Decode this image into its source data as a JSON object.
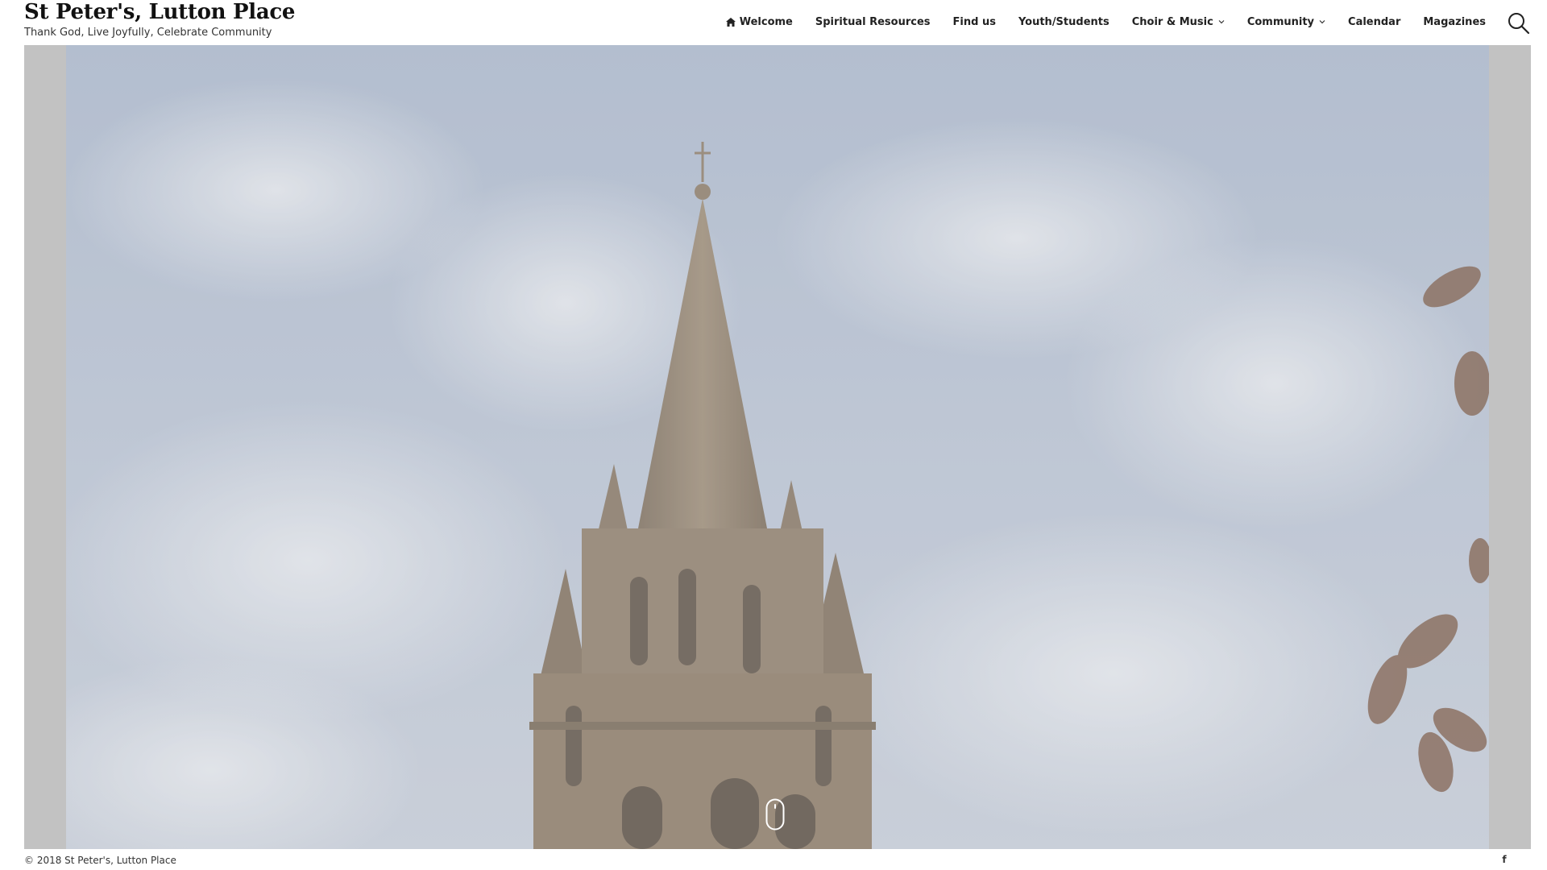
{
  "site": {
    "title": "St Peter's, Lutton Place",
    "tagline": "Thank God, Live Joyfully, Celebrate Community"
  },
  "nav": {
    "items": [
      {
        "label": "Welcome",
        "icon": "home-icon",
        "has_dropdown": false
      },
      {
        "label": "Spiritual Resources",
        "has_dropdown": false
      },
      {
        "label": "Find us",
        "has_dropdown": false
      },
      {
        "label": "Youth/Students",
        "has_dropdown": false
      },
      {
        "label": "Choir & Music",
        "has_dropdown": true
      },
      {
        "label": "Community",
        "has_dropdown": true
      },
      {
        "label": "Calendar",
        "has_dropdown": false
      },
      {
        "label": "Magazines",
        "has_dropdown": false
      }
    ],
    "search_icon": "search-icon"
  },
  "hero": {
    "image": "church-spire-against-cloudy-sky",
    "scroll_icon": "mouse-scroll-icon"
  },
  "footer": {
    "copyright": "© 2018 St Peter's, Lutton Place",
    "social_icon": "facebook-icon",
    "social_glyph": "f"
  },
  "colors": {
    "hero_frame": "#c2c2c2",
    "sky": "#b3bed0",
    "stone": "#8a7a68",
    "text": "#222222"
  }
}
